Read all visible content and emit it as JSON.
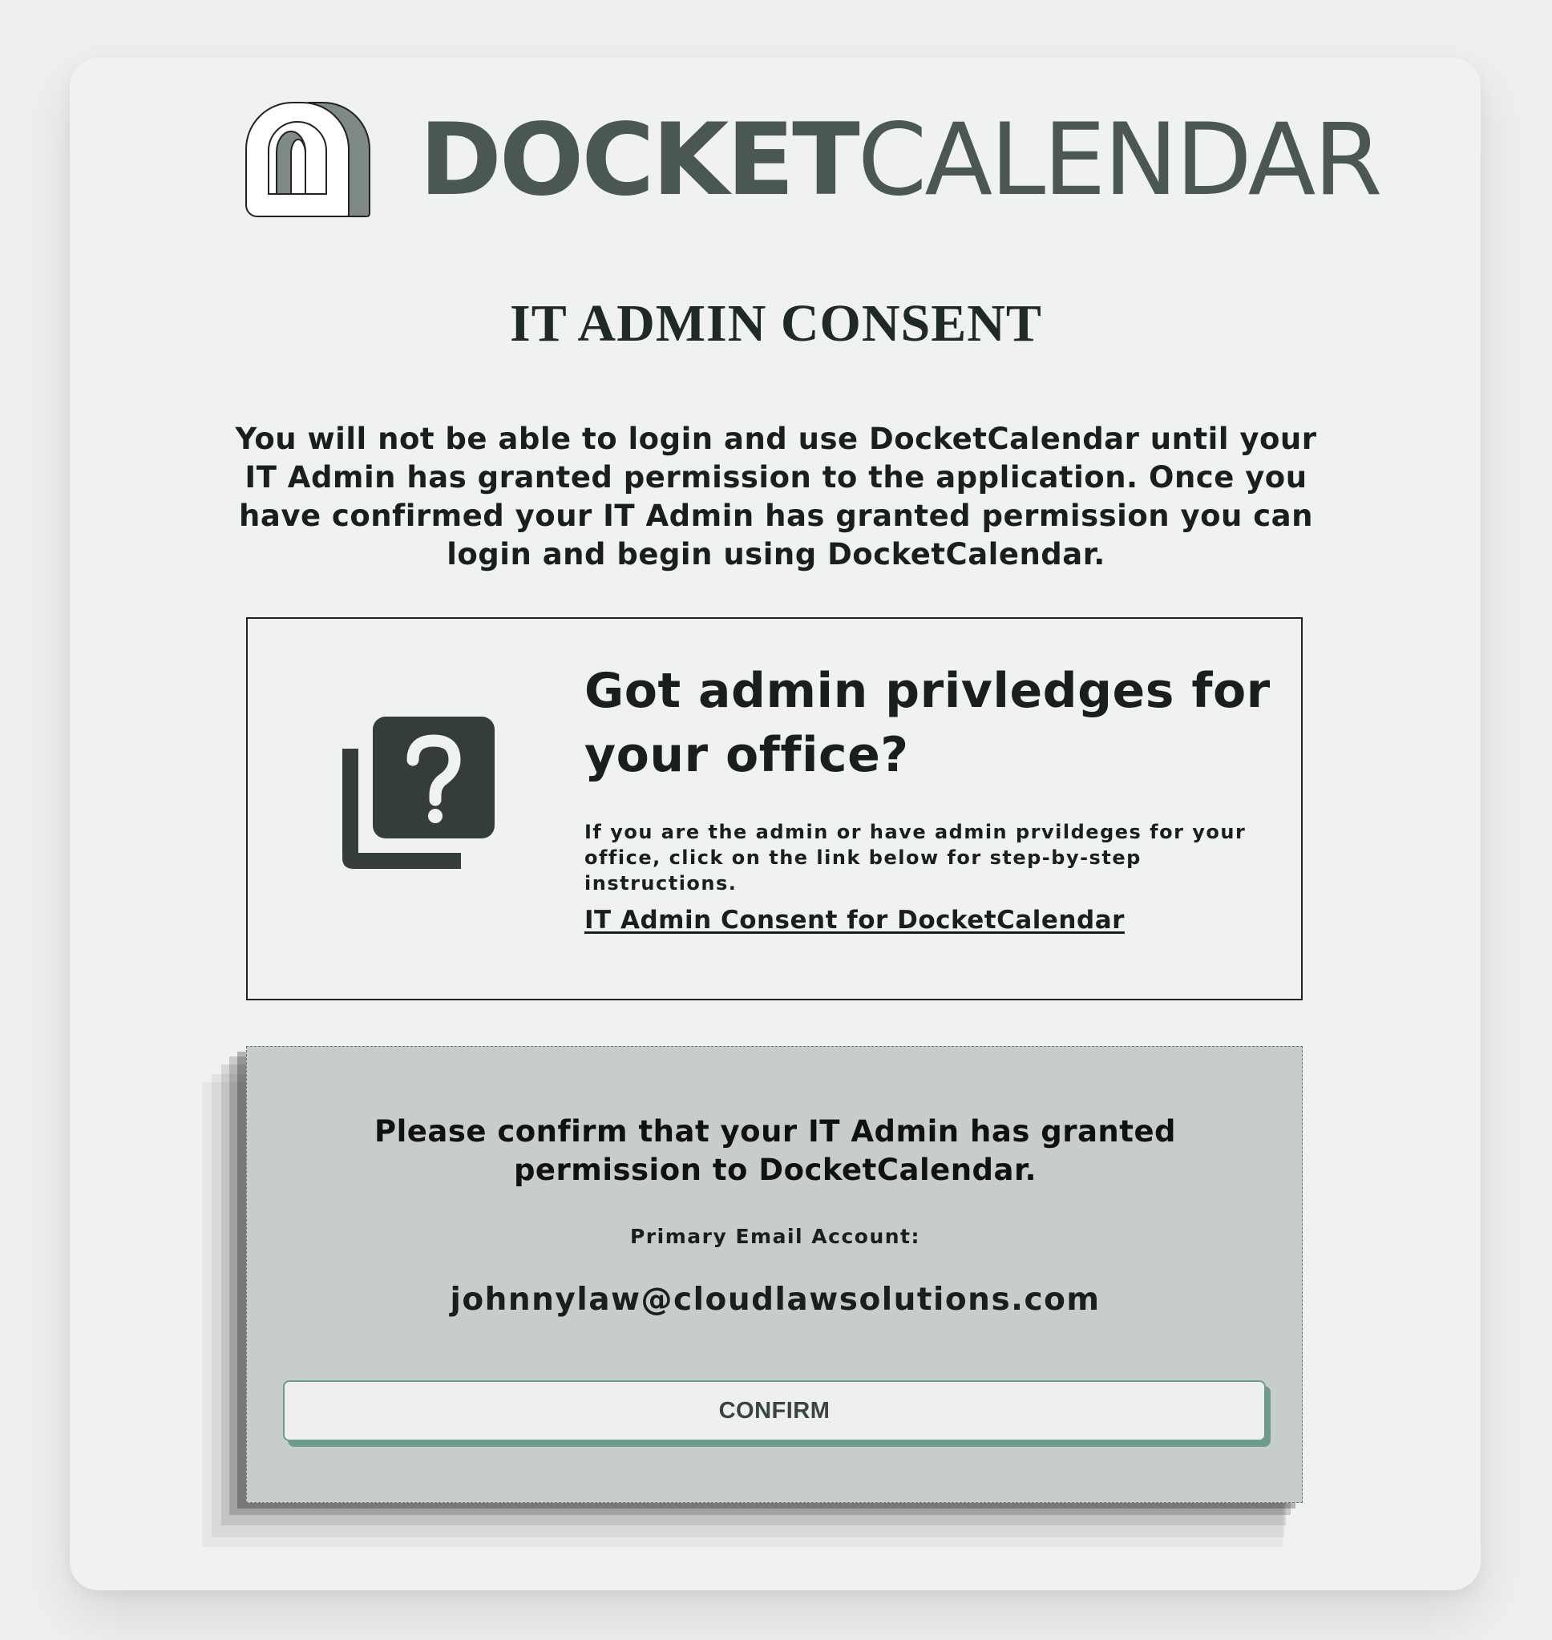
{
  "logo": {
    "bold_part": "DOCKET",
    "light_part": "CALENDAR"
  },
  "page": {
    "title": "IT ADMIN CONSENT",
    "intro": "You will not be able to login and use DocketCalendar until your IT Admin has granted permission to the application. Once you have confirmed your IT Admin has granted permission you can login and begin using DocketCalendar."
  },
  "admin_box": {
    "icon": "question-library-icon",
    "heading": "Got admin privledges for your office?",
    "text": "If you are the admin or have admin prvildeges for your office, click on the link below for step-by-step instructions.",
    "link_label": "IT Admin Consent for DocketCalendar"
  },
  "confirm_panel": {
    "title": "Please confirm that your IT Admin has granted permission to DocketCalendar.",
    "email_label": "Primary Email Account:",
    "email_value": "johnnylaw@cloudlawsolutions.com",
    "button_label": "CONFIRM"
  },
  "colors": {
    "background": "#eef0ef",
    "card": "#f0f2f1",
    "brand": "#4a5752",
    "icon": "#353d3a",
    "panel": "#c6cdcb",
    "accent": "#6f9c8a"
  }
}
